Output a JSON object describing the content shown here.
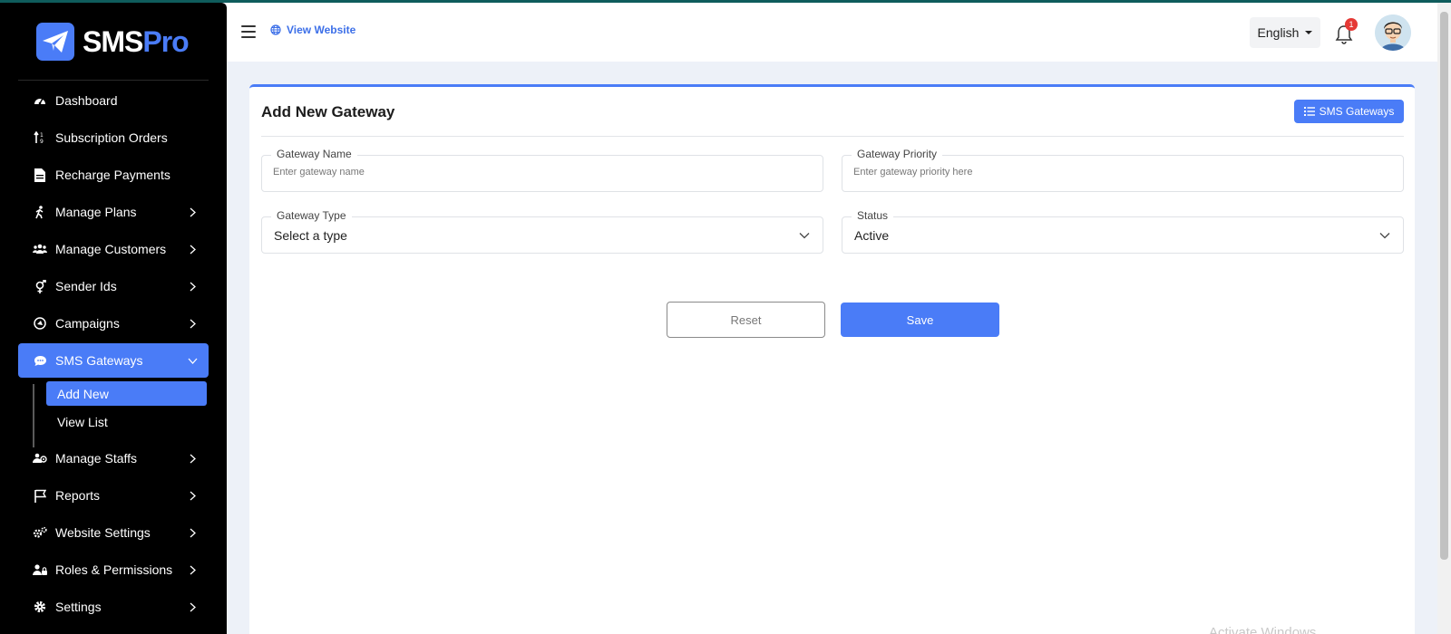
{
  "brand": {
    "name_part1": "SMS",
    "name_part2": "Pro",
    "accent": "#4a7cf7"
  },
  "sidebar": {
    "items": [
      {
        "label": "Dashboard",
        "icon": "gauge-icon"
      },
      {
        "label": "Subscription Orders",
        "icon": "sort-arrows-icon"
      },
      {
        "label": "Recharge Payments",
        "icon": "invoice-icon"
      },
      {
        "label": "Manage Plans",
        "icon": "walking-person-icon"
      },
      {
        "label": "Manage Customers",
        "icon": "users-icon"
      },
      {
        "label": "Sender Ids",
        "icon": "key-icon"
      },
      {
        "label": "Campaigns",
        "icon": "campaign-icon"
      },
      {
        "label": "SMS Gateways",
        "icon": "chat-bubble-icon"
      },
      {
        "label": "Manage Staffs",
        "icon": "staff-icon"
      },
      {
        "label": "Reports",
        "icon": "flag-icon"
      },
      {
        "label": "Website Settings",
        "icon": "gears-icon"
      },
      {
        "label": "Roles & Permissions",
        "icon": "user-lock-icon"
      },
      {
        "label": "Settings",
        "icon": "gear-icon"
      }
    ],
    "submenu": [
      {
        "label": "Add New"
      },
      {
        "label": "View List"
      }
    ]
  },
  "header": {
    "view_website": "View Website",
    "language": "English",
    "notification_count": "1"
  },
  "card": {
    "title": "Add New Gateway",
    "list_button": "SMS Gateways",
    "fields": {
      "gateway_name": {
        "label": "Gateway Name",
        "placeholder": "Enter gateway name",
        "value": ""
      },
      "gateway_priority": {
        "label": "Gateway Priority",
        "placeholder": "Enter gateway priority here",
        "value": ""
      },
      "gateway_type": {
        "label": "Gateway Type",
        "value": "Select a type"
      },
      "status": {
        "label": "Status",
        "value": "Active"
      }
    },
    "reset_label": "Reset",
    "save_label": "Save"
  },
  "watermark": "Activate Windows"
}
